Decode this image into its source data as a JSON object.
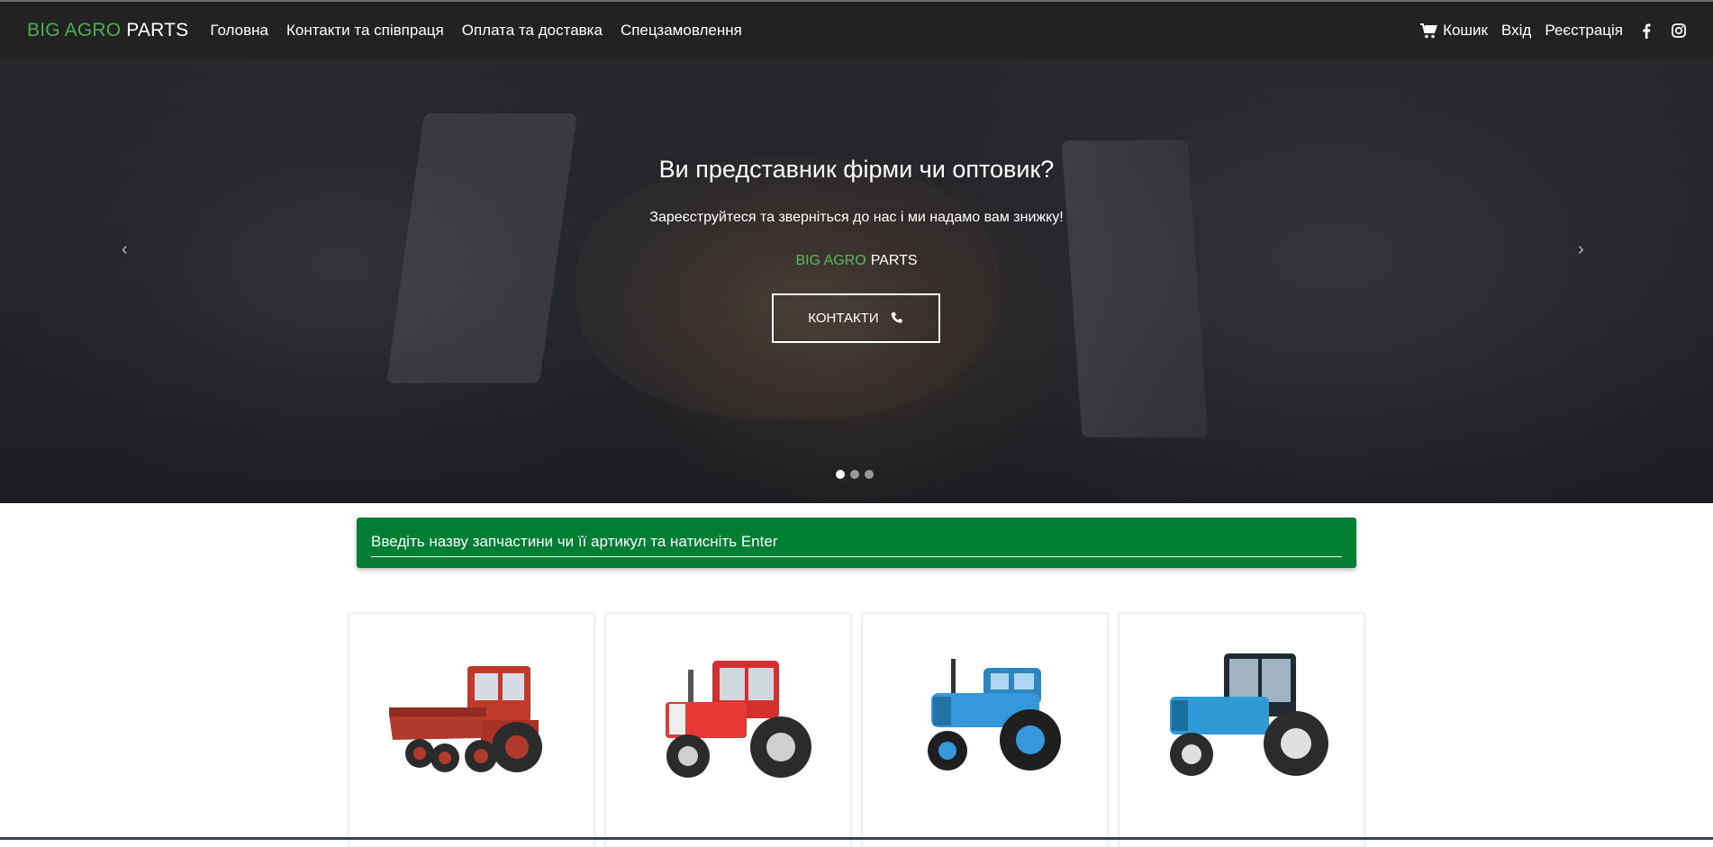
{
  "nav": {
    "brand": {
      "part1": "BIG AGRO",
      "part2": "PARTS"
    },
    "links": [
      "Головна",
      "Контакти та співпраця",
      "Оплата та доставка",
      "Спецзамовлення"
    ],
    "cart_label": "Кошик",
    "login_label": "Вхід",
    "register_label": "Реєстрація",
    "cart_icon": "cart-icon",
    "social_icons": [
      "facebook-icon",
      "instagram-icon"
    ]
  },
  "hero": {
    "title": "Ви представник фірми чи оптовик?",
    "subtitle": "Зареєструйтеся та зверніться до нас і ми надамо вам знижку!",
    "brand_part1": "BIG AGRO",
    "brand_part2": "PARTS",
    "button_label": "КОНТАКТИ",
    "button_icon": "phone-icon",
    "prev_arrow": "‹",
    "next_arrow": "›",
    "slide_count": 3,
    "active_slide": 1
  },
  "search": {
    "placeholder": "Введіть назву запчастини чи її артикул та натисніть Enter"
  },
  "products": [
    {
      "image": "red-self-propelled-chassis-tractor-image"
    },
    {
      "image": "red-tractor-image"
    },
    {
      "image": "blue-vintage-tractor-image"
    },
    {
      "image": "blue-modern-tractor-image"
    }
  ],
  "colors": {
    "navbar": "#222222",
    "brand_green": "#4cae4c",
    "search_green": "#007e33",
    "accent_white": "#ffffff"
  }
}
